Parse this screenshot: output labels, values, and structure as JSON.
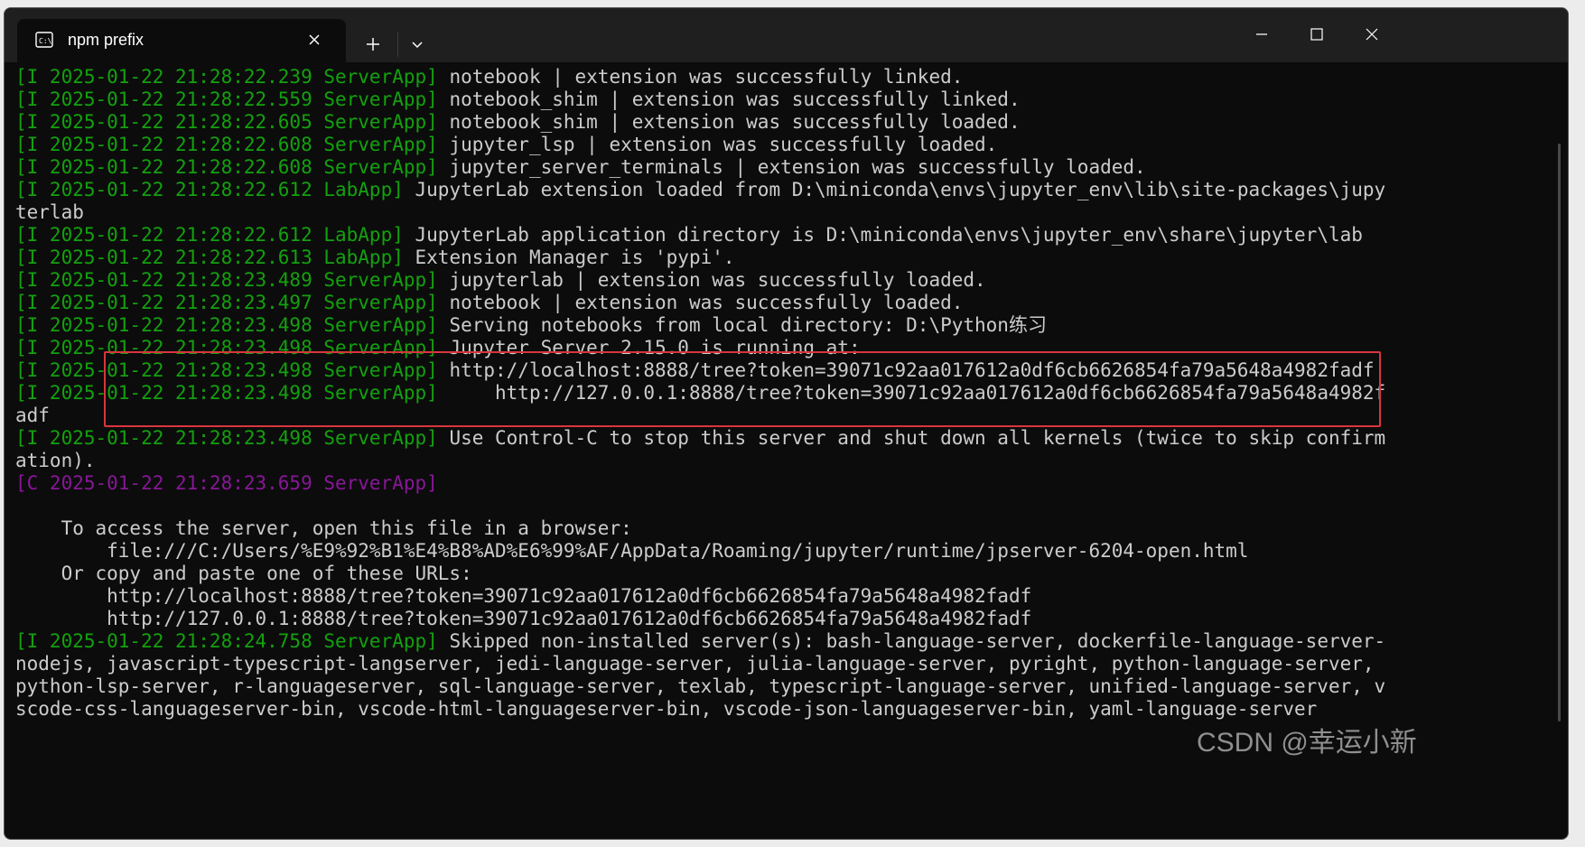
{
  "window": {
    "tab_title": "npm prefix",
    "tab_icon": "terminal-icon",
    "controls": [
      "minimize-icon",
      "maximize-icon",
      "close-icon"
    ]
  },
  "colors": {
    "background": "#0c0c0c",
    "text": "#cccccc",
    "info_prefix": "#13a10e",
    "critical_prefix": "#881798",
    "highlight_border": "#d8363c"
  },
  "terminal": {
    "lines": [
      {
        "prefix": "[I 2025-01-22 21:28:22.239 ServerApp]",
        "text": " notebook | extension was successfully linked.",
        "level": "info"
      },
      {
        "prefix": "[I 2025-01-22 21:28:22.559 ServerApp]",
        "text": " notebook_shim | extension was successfully linked.",
        "level": "info"
      },
      {
        "prefix": "[I 2025-01-22 21:28:22.605 ServerApp]",
        "text": " notebook_shim | extension was successfully loaded.",
        "level": "info"
      },
      {
        "prefix": "[I 2025-01-22 21:28:22.608 ServerApp]",
        "text": " jupyter_lsp | extension was successfully loaded.",
        "level": "info"
      },
      {
        "prefix": "[I 2025-01-22 21:28:22.608 ServerApp]",
        "text": " jupyter_server_terminals | extension was successfully loaded.",
        "level": "info"
      },
      {
        "prefix": "[I 2025-01-22 21:28:22.612 LabApp]",
        "text": " JupyterLab extension loaded from D:\\miniconda\\envs\\jupyter_env\\lib\\site-packages\\jupy",
        "level": "info"
      },
      {
        "prefix": "",
        "text": "terlab",
        "level": "plain"
      },
      {
        "prefix": "[I 2025-01-22 21:28:22.612 LabApp]",
        "text": " JupyterLab application directory is D:\\miniconda\\envs\\jupyter_env\\share\\jupyter\\lab",
        "level": "info"
      },
      {
        "prefix": "[I 2025-01-22 21:28:22.613 LabApp]",
        "text": " Extension Manager is 'pypi'.",
        "level": "info"
      },
      {
        "prefix": "[I 2025-01-22 21:28:23.489 ServerApp]",
        "text": " jupyterlab | extension was successfully loaded.",
        "level": "info"
      },
      {
        "prefix": "[I 2025-01-22 21:28:23.497 ServerApp]",
        "text": " notebook | extension was successfully loaded.",
        "level": "info"
      },
      {
        "prefix": "[I 2025-01-22 21:28:23.498 ServerApp]",
        "text": " Serving notebooks from local directory: D:\\Python练习",
        "level": "info"
      },
      {
        "prefix": "[I 2025-01-22 21:28:23.498 ServerApp]",
        "text": " Jupyter Server 2.15.0 is running at:",
        "level": "info"
      },
      {
        "prefix": "[I 2025-01-22 21:28:23.498 ServerApp]",
        "text": " http://localhost:8888/tree?token=39071c92aa017612a0df6cb6626854fa79a5648a4982fadf",
        "level": "info"
      },
      {
        "prefix": "[I 2025-01-22 21:28:23.498 ServerApp]",
        "text": "     http://127.0.0.1:8888/tree?token=39071c92aa017612a0df6cb6626854fa79a5648a4982f",
        "level": "info"
      },
      {
        "prefix": "",
        "text": "adf",
        "level": "plain"
      },
      {
        "prefix": "[I 2025-01-22 21:28:23.498 ServerApp]",
        "text": " Use Control-C to stop this server and shut down all kernels (twice to skip confirm",
        "level": "info"
      },
      {
        "prefix": "",
        "text": "ation).",
        "level": "plain"
      },
      {
        "prefix": "[C 2025-01-22 21:28:23.659 ServerApp]",
        "text": "",
        "level": "critical"
      },
      {
        "prefix": "",
        "text": "",
        "level": "plain"
      },
      {
        "prefix": "",
        "text": "    To access the server, open this file in a browser:",
        "level": "plain"
      },
      {
        "prefix": "",
        "text": "        file:///C:/Users/%E9%92%B1%E4%B8%AD%E6%99%AF/AppData/Roaming/jupyter/runtime/jpserver-6204-open.html",
        "level": "plain"
      },
      {
        "prefix": "",
        "text": "    Or copy and paste one of these URLs:",
        "level": "plain"
      },
      {
        "prefix": "",
        "text": "        http://localhost:8888/tree?token=39071c92aa017612a0df6cb6626854fa79a5648a4982fadf",
        "level": "plain"
      },
      {
        "prefix": "",
        "text": "        http://127.0.0.1:8888/tree?token=39071c92aa017612a0df6cb6626854fa79a5648a4982fadf",
        "level": "plain"
      },
      {
        "prefix": "[I 2025-01-22 21:28:24.758 ServerApp]",
        "text": " Skipped non-installed server(s): bash-language-server, dockerfile-language-server-",
        "level": "info"
      },
      {
        "prefix": "",
        "text": "nodejs, javascript-typescript-langserver, jedi-language-server, julia-language-server, pyright, python-language-server,",
        "level": "plain"
      },
      {
        "prefix": "",
        "text": "python-lsp-server, r-languageserver, sql-language-server, texlab, typescript-language-server, unified-language-server, v",
        "level": "plain"
      },
      {
        "prefix": "",
        "text": "scode-css-languageserver-bin, vscode-html-languageserver-bin, vscode-json-languageserver-bin, yaml-language-server",
        "level": "plain"
      }
    ]
  },
  "watermark": "CSDN @幸运小新"
}
